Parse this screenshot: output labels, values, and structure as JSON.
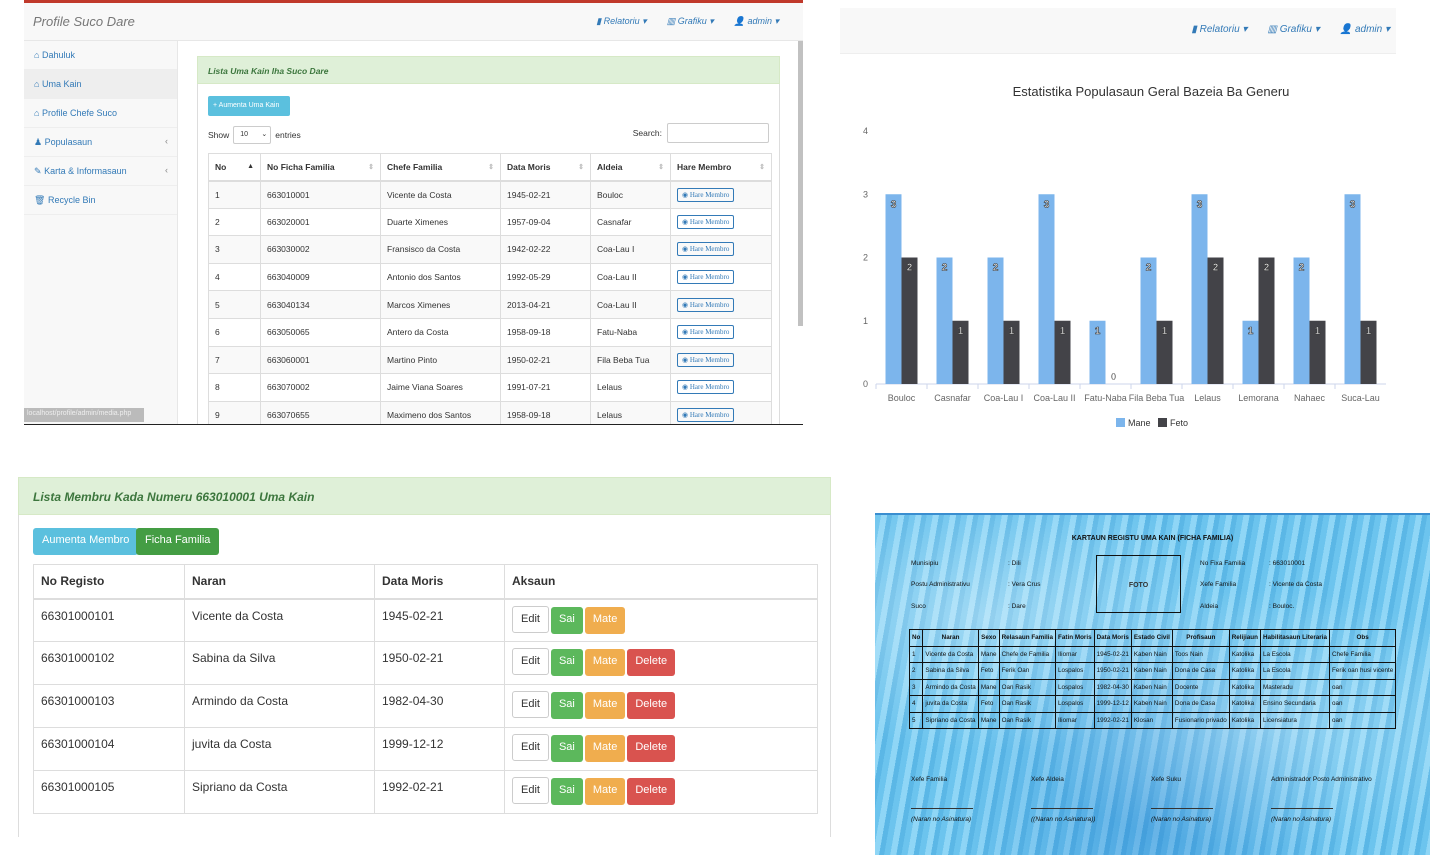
{
  "panel1": {
    "brand": "Profile Suco Dare",
    "topmenu": [
      "Relatoriu ▾",
      "Grafiku ▾",
      "admin ▾"
    ],
    "sidebar": [
      {
        "icon": "dashboard-icon",
        "label": "Dahuluk",
        "chev": ""
      },
      {
        "icon": "home-icon",
        "label": "Uma Kain",
        "chev": ""
      },
      {
        "icon": "home-icon",
        "label": "Profile Chefe Suco",
        "chev": ""
      },
      {
        "icon": "user-icon",
        "label": "Populasaun",
        "chev": "‹"
      },
      {
        "icon": "pencil-icon",
        "label": "Karta & Informasaun",
        "chev": "‹"
      },
      {
        "icon": "trash-icon",
        "label": "Recycle Bin",
        "chev": ""
      }
    ],
    "url": "localhost/profile/admin/media.php",
    "panel_title": "Lista Uma Kain Iha Suco Dare",
    "add_button": "+ Aumenta Uma Kain",
    "show_label": "Show",
    "entries_value": "10",
    "entries_label": "entries",
    "search_label": "Search:",
    "columns": [
      "No",
      "No Ficha Familia",
      "Chefe Familia",
      "Data Moris",
      "Aldeia",
      "Hare Membro"
    ],
    "hare_label": "Hare Membro",
    "rows": [
      [
        "1",
        "663010001",
        "Vicente da Costa",
        "1945-02-21",
        "Bouloc"
      ],
      [
        "2",
        "663020001",
        "Duarte Ximenes",
        "1957-09-04",
        "Casnafar"
      ],
      [
        "3",
        "663030002",
        "Fransisco da Costa",
        "1942-02-22",
        "Coa-Lau I"
      ],
      [
        "4",
        "663040009",
        "Antonio dos Santos",
        "1992-05-29",
        "Coa-Lau II"
      ],
      [
        "5",
        "663040134",
        "Marcos Ximenes",
        "2013-04-21",
        "Coa-Lau II"
      ],
      [
        "6",
        "663050065",
        "Antero da Costa",
        "1958-09-18",
        "Fatu-Naba"
      ],
      [
        "7",
        "663060001",
        "Martino Pinto",
        "1950-02-21",
        "Fila Beba Tua"
      ],
      [
        "8",
        "663070002",
        "Jaime Viana Soares",
        "1991-07-21",
        "Lelaus"
      ],
      [
        "9",
        "663070655",
        "Maximeno dos Santos",
        "1958-09-18",
        "Lelaus"
      ]
    ]
  },
  "panel2": {
    "topmenu": [
      "Relatoriu ▾",
      "Grafiku ▾",
      "admin ▾"
    ]
  },
  "chart_data": {
    "type": "bar",
    "title": "Estatistika Populasaun Geral Bazeia Ba Generu",
    "categories": [
      "Bouloc",
      "Casnafar",
      "Coa-Lau I",
      "Coa-Lau II",
      "Fatu-Naba",
      "Fila Beba Tua",
      "Lelaus",
      "Lemorana",
      "Nahaec",
      "Suca-Lau"
    ],
    "series": [
      {
        "name": "Mane",
        "values": [
          3,
          2,
          2,
          3,
          1,
          2,
          3,
          1,
          2,
          3
        ],
        "color": "#7cb5ec"
      },
      {
        "name": "Feto",
        "values": [
          2,
          1,
          1,
          1,
          0,
          1,
          2,
          2,
          1,
          1
        ],
        "color": "#434348"
      }
    ],
    "ylim": [
      0,
      4
    ],
    "yticks": [
      "0",
      "1",
      "2",
      "3",
      "4"
    ],
    "grid": false,
    "legend": "bottom-center"
  },
  "panel3": {
    "title": "Lista Membru Kada Numeru 663010001 Uma Kain",
    "btn_add": "Aumenta Membro",
    "btn_ficha": "Ficha Familia",
    "columns": [
      "No Registo",
      "Naran",
      "Data Moris",
      "Aksaun"
    ],
    "actions": {
      "edit": "Edit",
      "sai": "Sai",
      "mate": "Mate",
      "delete": "Delete"
    },
    "rows": [
      {
        "no": "66301000101",
        "naran": "Vicente da Costa",
        "data": "1945-02-21",
        "delete": false
      },
      {
        "no": "66301000102",
        "naran": "Sabina da Silva",
        "data": "1950-02-21",
        "delete": true
      },
      {
        "no": "66301000103",
        "naran": "Armindo da Costa",
        "data": "1982-04-30",
        "delete": true
      },
      {
        "no": "66301000104",
        "naran": "juvita da Costa",
        "data": "1999-12-12",
        "delete": true
      },
      {
        "no": "66301000105",
        "naran": "Sipriano da Costa",
        "data": "1992-02-21",
        "delete": true
      }
    ]
  },
  "panel4": {
    "title": "KARTAUN REGISTU UMA KAIN (FICHA FAMILIA)",
    "left_fields": [
      {
        "label": "Munisipiu",
        "value": ": Dili"
      },
      {
        "label": "Postu Administrativu",
        "value": ": Vera Crus"
      },
      {
        "label": "Suco",
        "value": ": Dare"
      }
    ],
    "foto": "FOTO",
    "right_fields": [
      {
        "label": "No Fixa Familia",
        "value": ": 663010001"
      },
      {
        "label": "Xefe Familia",
        "value": ": Vicente da Costa"
      },
      {
        "label": "Aldeia",
        "value": ": Bouloc."
      }
    ],
    "columns": [
      "No",
      "Naran",
      "Sexo",
      "Relasaun Familia",
      "Fatin Moris",
      "Data Moris",
      "Estado Civil",
      "Profisaun",
      "Relijiaun",
      "Habilitasaun Literaria",
      "Obs"
    ],
    "rows": [
      [
        "1",
        "Vicente da Costa",
        "Mane",
        "Chefe de Familia",
        "Iliomar",
        "1945-02-21",
        "Kaben Nain",
        "Toos Nain",
        "Katolika",
        "La Escola",
        "Chefe Familia"
      ],
      [
        "2",
        "Sabina da Silva",
        "Feto",
        "Ferik Oan",
        "Lospalos",
        "1950-02-21",
        "Kaben Nain",
        "Dona de Casa",
        "Katolika",
        "La Escola",
        "Ferik oan husi vicente"
      ],
      [
        "3",
        "Armindo da Costa",
        "Mane",
        "Oan Rasik",
        "Lospalos",
        "1982-04-30",
        "Kaben Nain",
        "Docente",
        "Katolika",
        "Masteradu",
        "oan"
      ],
      [
        "4",
        "juvita da Costa",
        "Feto",
        "Oan Rasik",
        "Lospalos",
        "1999-12-12",
        "Kaben Nain",
        "Dona de Casa",
        "Katolika",
        "Ensino Secundaria",
        "oan"
      ],
      [
        "5",
        "Sipriano da Costa",
        "Mane",
        "Oan Rasik",
        "Iliomar",
        "1992-02-21",
        "Klosan",
        "Fusionario privado",
        "Katolika",
        "Licensiatura",
        "oan"
      ]
    ],
    "signatures": [
      {
        "role": "Xefe Familia",
        "name": "(Naran no Asinatura)"
      },
      {
        "role": "Xefe Aldeia",
        "name": "((Naran no Asinatura))"
      },
      {
        "role": "Xefe Suku",
        "name": "(Naran no Asinatura)"
      },
      {
        "role": "Administrador Posto Administrativo",
        "name": "(Naran no Asinatura)"
      }
    ]
  }
}
